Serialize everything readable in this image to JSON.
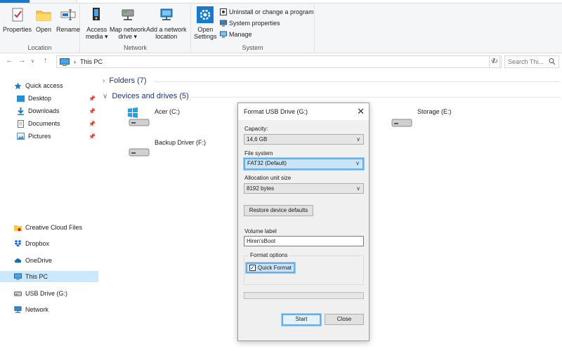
{
  "ribbon": {
    "location": {
      "label": "Location",
      "properties": "Properties",
      "open": "Open",
      "rename": "Rename"
    },
    "network": {
      "label": "Network",
      "access_media_1": "Access",
      "access_media_2": "media ▾",
      "map_network_1": "Map network",
      "map_network_2": "drive ▾",
      "add_location_1": "Add a network",
      "add_location_2": "location"
    },
    "system": {
      "label": "System",
      "open_settings_1": "Open",
      "open_settings_2": "Settings",
      "uninstall": "Uninstall or change a program",
      "system_properties": "System properties",
      "manage": "Manage"
    }
  },
  "address_bar": {
    "separator": "›",
    "path": "This PC",
    "search_placeholder": "Search Thi..."
  },
  "nav_pane": {
    "quick_access": "Quick access",
    "desktop": "Desktop",
    "downloads": "Downloads",
    "documents": "Documents",
    "pictures": "Pictures",
    "creative_cloud": "Creative Cloud Files",
    "dropbox": "Dropbox",
    "onedrive": "OneDrive",
    "this_pc": "This PC",
    "usb_drive": "USB Drive (G:)",
    "network": "Network"
  },
  "content": {
    "folders_header": "Folders (7)",
    "devices_header": "Devices and drives (5)",
    "drives": {
      "acer": "Acer (C:)",
      "backup": "Backup Driver (F:)",
      "storage": "Storage (E:)"
    }
  },
  "dialog": {
    "title": "Format USB Drive (G:)",
    "capacity_label": "Capacity:",
    "capacity_value": "14,6 GB",
    "filesystem_label": "File system",
    "filesystem_value": "FAT32 (Default)",
    "allocation_label": "Allocation unit size",
    "allocation_value": "8192 bytes",
    "restore_button": "Restore device defaults",
    "volume_label": "Volume label",
    "volume_value": "Hiren'sBoot",
    "format_options_label": "Format options",
    "quick_format_label": "Quick Format",
    "quick_format_checked": true,
    "progress": 0,
    "start_button": "Start",
    "close_button": "Close"
  },
  "colors": {
    "accent": "#1979ca",
    "selection": "#cce8ff",
    "focus_border": "#6aaee8",
    "section_header": "#1e3287"
  }
}
